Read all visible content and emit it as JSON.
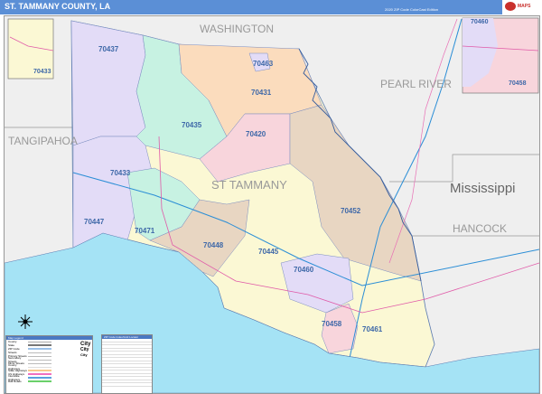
{
  "header": {
    "title": "ST. TAMMANY COUNTY, LA",
    "edition": "2020 ZIP Code ColorCast Edition",
    "logo_text": "MAPS"
  },
  "map": {
    "county_label": "ST TAMMANY",
    "neighbors": [
      "WASHINGTON",
      "PEARL RIVER",
      "TANGIPAHOA",
      "HANCOCK"
    ],
    "state_label": "Mississippi",
    "zips": [
      "70437",
      "70463",
      "70431",
      "70435",
      "70420",
      "70433",
      "70447",
      "70471",
      "70448",
      "70445",
      "70452",
      "70460",
      "70458",
      "70461"
    ],
    "inset_left_zip": "70433",
    "inset_right_zips": [
      "70460",
      "70458"
    ],
    "colors": {
      "water": "#a5e3f5",
      "land": "#efefef",
      "purple": "#e3dcf7",
      "green": "#c7f2e2",
      "orange": "#fbdcbd",
      "pink": "#f8d5dc",
      "yellow": "#fbf8d4",
      "tan": "#e8d6c2",
      "header": "#5b8fd6"
    }
  },
  "legend": {
    "title": "Map Legend",
    "items": [
      "County",
      "State",
      "ZIP Code",
      "Streets",
      "Primary Streets",
      "Secondary Streets",
      "Minor Streets",
      "County Highways",
      "State Highways",
      "US Highways",
      "Interstate Highways",
      "Rail Roads"
    ],
    "cities": [
      "City",
      "City",
      "City"
    ]
  },
  "index": {
    "title": "ZIP Code Index/Grid Locator"
  }
}
